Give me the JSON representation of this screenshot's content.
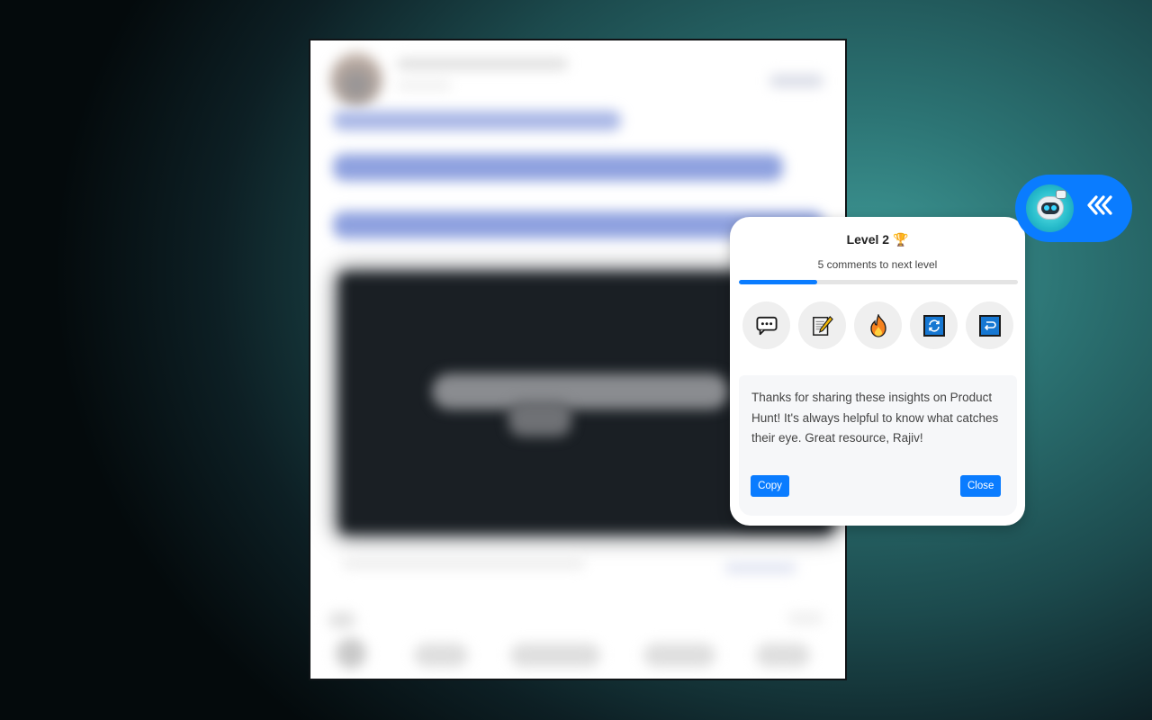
{
  "post": {
    "blurred": true,
    "description": "Blurred social media post (content not legible)"
  },
  "popup": {
    "level_label": "Level 2",
    "trophy_icon": "🏆",
    "subtitle": "5 comments to next level",
    "progress_fraction": 0.28,
    "colors": {
      "accent": "#0a7cff",
      "track": "#e4e4e4"
    },
    "actions": [
      {
        "name": "comment",
        "icon": "speech-bubble-icon",
        "glyph": "💬"
      },
      {
        "name": "write",
        "icon": "memo-pencil-icon",
        "glyph": "📝"
      },
      {
        "name": "fire",
        "icon": "fire-icon",
        "glyph": "🔥"
      },
      {
        "name": "regenerate",
        "icon": "refresh-icon",
        "glyph": "🔄"
      },
      {
        "name": "reply",
        "icon": "return-arrow-icon",
        "glyph": "↩"
      }
    ],
    "reply_text": "Thanks for sharing these insights on Product Hunt! It's always helpful to know what catches their eye. Great resource, Rajiv!",
    "copy_label": "Copy",
    "close_label": "Close"
  },
  "launcher": {
    "avatar_icon": "robot-avatar-icon",
    "collapse_glyph": "«‹"
  }
}
